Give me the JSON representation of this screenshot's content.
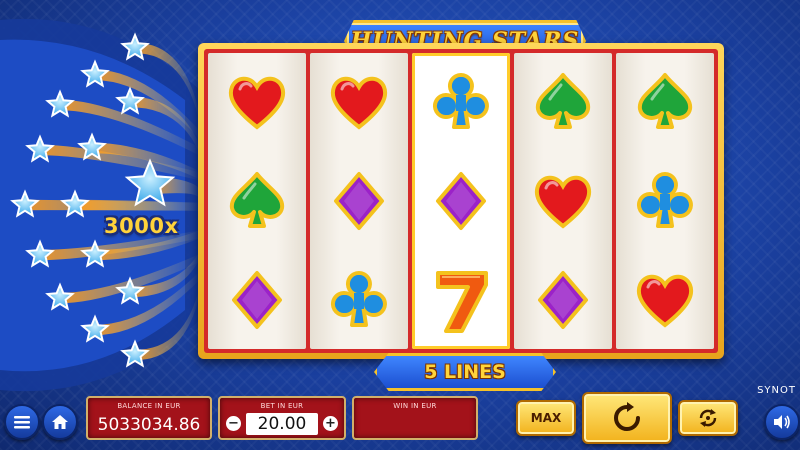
{
  "game": {
    "title": "HUNTING STARS",
    "multiplier": "3000x",
    "lines_label": "5 LINES",
    "provider": "SYNOT"
  },
  "reels": [
    [
      "heart",
      "spade",
      "diamond"
    ],
    [
      "heart",
      "diamond",
      "club"
    ],
    [
      "club",
      "diamond",
      "seven"
    ],
    [
      "spade",
      "heart",
      "diamond"
    ],
    [
      "spade",
      "club",
      "heart"
    ]
  ],
  "symbol_colors": {
    "heart": "#e3191d",
    "spade": "#1fa53a",
    "club": "#1f8ee0",
    "diamond": "#9b22c8",
    "seven": "#f05a10",
    "gold_border": "#f4c21d"
  },
  "controls": {
    "balance_label": "BALANCE IN EUR",
    "balance_value": "5033034.86",
    "bet_label": "BET IN EUR",
    "bet_value": "20.00",
    "bet_minus": "−",
    "bet_plus": "+",
    "win_label": "WIN IN EUR",
    "win_value": "",
    "max_label": "MAX"
  },
  "icons": {
    "menu": "menu-icon",
    "home": "home-icon",
    "spin": "spin-arrow-icon",
    "autoplay": "autoplay-icon",
    "sound": "sound-icon"
  }
}
